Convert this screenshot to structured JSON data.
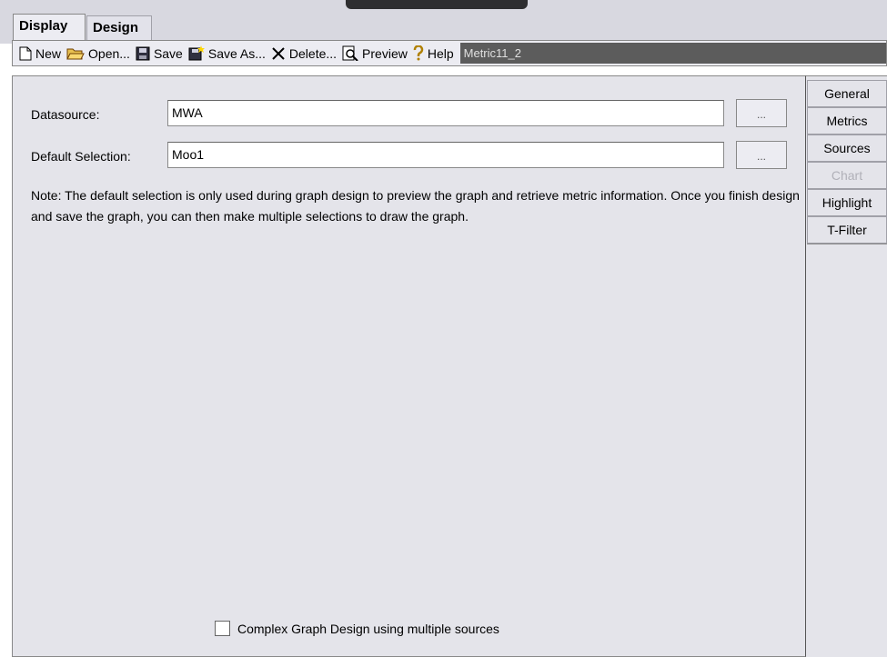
{
  "tabs": [
    {
      "label": "Display",
      "active": true
    },
    {
      "label": "Design",
      "active": false
    }
  ],
  "toolbar": {
    "new_label": "New",
    "open_label": "Open...",
    "save_label": "Save",
    "save_as_label": "Save As...",
    "delete_label": "Delete...",
    "preview_label": "Preview",
    "help_label": "Help",
    "title_value": "Metric11_2"
  },
  "form": {
    "datasource_label": "Datasource:",
    "datasource_value": "MWA",
    "datasource_button": "...",
    "default_label": "Default Selection:",
    "default_value": "Moo1",
    "default_button": "...",
    "note": "Note: The default selection is only used during graph design to preview the graph and retrieve metric information.  Once you finish design and save the graph, you can then make multiple selections to draw the graph.",
    "complex_checkbox_label": "Complex Graph Design using multiple sources",
    "complex_checked": false
  },
  "side_tabs": [
    {
      "label": "General",
      "enabled": true
    },
    {
      "label": "Metrics",
      "enabled": true
    },
    {
      "label": "Sources",
      "enabled": true
    },
    {
      "label": "Chart",
      "enabled": false
    },
    {
      "label": "Highlight",
      "enabled": true
    },
    {
      "label": "T-Filter",
      "enabled": true
    }
  ],
  "colors": {
    "panel_bg": "#e4e4ea",
    "title_field_bg": "#5c5c5c",
    "disabled_text": "#b0b0b8"
  },
  "icons": [
    "new-icon",
    "open-icon",
    "save-icon",
    "save-as-icon",
    "delete-icon",
    "preview-icon",
    "help-icon"
  ]
}
